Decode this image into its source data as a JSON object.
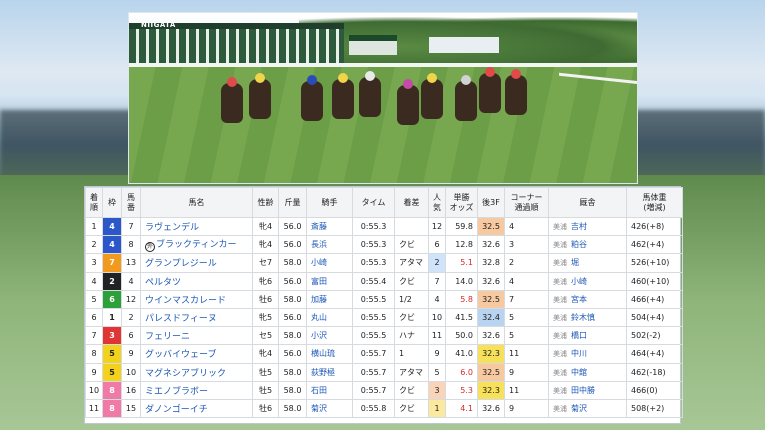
{
  "video": {
    "gate_sign": "NIIGATA",
    "tent_sign": "NIIGATA RACECOURSE"
  },
  "table": {
    "headers": [
      "着順",
      "枠",
      "馬番",
      "馬名",
      "性齢",
      "斤量",
      "騎手",
      "タイム",
      "着差",
      "人気",
      "単勝オッズ",
      "後3F",
      "コーナー通過順",
      "厩舎",
      "馬体重(増減)"
    ],
    "header_lines": {
      "col0": [
        "着",
        "順"
      ],
      "col2": [
        "馬",
        "番"
      ],
      "col9": [
        "人",
        "気"
      ],
      "col10": [
        "単勝",
        "オッズ"
      ],
      "col12": [
        "コーナー",
        "通過順"
      ],
      "col14": [
        "馬体重",
        "(増減)"
      ]
    },
    "rows": [
      {
        "rank": "1",
        "waku": "4",
        "num": "7",
        "mark": "",
        "name": "ラヴェンデル",
        "sexage": "牝4",
        "weight": "56.0",
        "jockey": "斎藤",
        "time": "0:55.3",
        "margin": "",
        "pop": "12",
        "odds": "59.8",
        "l3f": "32.5",
        "corner": "4",
        "loc": "美浦",
        "trainer": "吉村",
        "bw": "426(+8)"
      },
      {
        "rank": "2",
        "waku": "4",
        "num": "8",
        "mark": "外",
        "name": "ブラックティンカー",
        "sexage": "牝4",
        "weight": "56.0",
        "jockey": "長浜",
        "time": "0:55.3",
        "margin": "クビ",
        "pop": "6",
        "odds": "12.8",
        "l3f": "32.6",
        "corner": "3",
        "loc": "美浦",
        "trainer": "粕谷",
        "bw": "462(+4)"
      },
      {
        "rank": "3",
        "waku": "7",
        "num": "13",
        "mark": "",
        "name": "グランプレジール",
        "sexage": "セ7",
        "weight": "58.0",
        "jockey": "小崎",
        "time": "0:55.3",
        "margin": "アタマ",
        "pop": "2",
        "odds": "5.1",
        "l3f": "32.8",
        "corner": "2",
        "loc": "美浦",
        "trainer": "堀",
        "bw": "526(+10)"
      },
      {
        "rank": "4",
        "waku": "2",
        "num": "4",
        "mark": "",
        "name": "ペルタツ",
        "sexage": "牝6",
        "weight": "56.0",
        "jockey": "富田",
        "time": "0:55.4",
        "margin": "クビ",
        "pop": "7",
        "odds": "14.0",
        "l3f": "32.6",
        "corner": "4",
        "loc": "美浦",
        "trainer": "小崎",
        "bw": "460(+10)"
      },
      {
        "rank": "5",
        "waku": "6",
        "num": "12",
        "mark": "",
        "name": "ウインマスカレード",
        "sexage": "牡6",
        "weight": "58.0",
        "jockey": "加藤",
        "time": "0:55.5",
        "margin": "1/2",
        "pop": "4",
        "odds": "5.8",
        "l3f": "32.5",
        "corner": "7",
        "loc": "美浦",
        "trainer": "宮本",
        "bw": "466(+4)"
      },
      {
        "rank": "6",
        "waku": "1",
        "num": "2",
        "mark": "",
        "name": "パレスドフィーヌ",
        "sexage": "牝5",
        "weight": "56.0",
        "jockey": "丸山",
        "time": "0:55.5",
        "margin": "クビ",
        "pop": "10",
        "odds": "41.5",
        "l3f": "32.4",
        "corner": "5",
        "loc": "美浦",
        "trainer": "鈴木慎",
        "bw": "504(+4)"
      },
      {
        "rank": "7",
        "waku": "3",
        "num": "6",
        "mark": "",
        "name": "フェリーニ",
        "sexage": "セ5",
        "weight": "58.0",
        "jockey": "小沢",
        "time": "0:55.5",
        "margin": "ハナ",
        "pop": "11",
        "odds": "50.0",
        "l3f": "32.6",
        "corner": "5",
        "loc": "美浦",
        "trainer": "橋口",
        "bw": "502(-2)"
      },
      {
        "rank": "8",
        "waku": "5",
        "num": "9",
        "mark": "",
        "name": "グッバイウェーブ",
        "sexage": "牝4",
        "weight": "56.0",
        "jockey": "横山琉",
        "time": "0:55.7",
        "margin": "1",
        "pop": "9",
        "odds": "41.0",
        "l3f": "32.3",
        "corner": "11",
        "loc": "美浦",
        "trainer": "中川",
        "bw": "464(+4)"
      },
      {
        "rank": "9",
        "waku": "5",
        "num": "10",
        "mark": "",
        "name": "マグネシアブリック",
        "sexage": "牡5",
        "weight": "58.0",
        "jockey": "荻野極",
        "time": "0:55.7",
        "margin": "アタマ",
        "pop": "5",
        "odds": "6.0",
        "l3f": "32.5",
        "corner": "9",
        "loc": "美浦",
        "trainer": "中舘",
        "bw": "462(-18)"
      },
      {
        "rank": "10",
        "waku": "8",
        "num": "16",
        "mark": "",
        "name": "ミエノブラボー",
        "sexage": "牡5",
        "weight": "58.0",
        "jockey": "石田",
        "time": "0:55.7",
        "margin": "クビ",
        "pop": "3",
        "odds": "5.3",
        "l3f": "32.3",
        "corner": "11",
        "loc": "美浦",
        "trainer": "田中勝",
        "bw": "466(0)"
      },
      {
        "rank": "11",
        "waku": "8",
        "num": "15",
        "mark": "",
        "name": "ダノンゴーイチ",
        "sexage": "牡6",
        "weight": "58.0",
        "jockey": "菊沢",
        "time": "0:55.8",
        "margin": "クビ",
        "pop": "1",
        "odds": "4.1",
        "l3f": "32.6",
        "corner": "9",
        "loc": "美浦",
        "trainer": "菊沢",
        "bw": "508(+2)"
      }
    ]
  }
}
